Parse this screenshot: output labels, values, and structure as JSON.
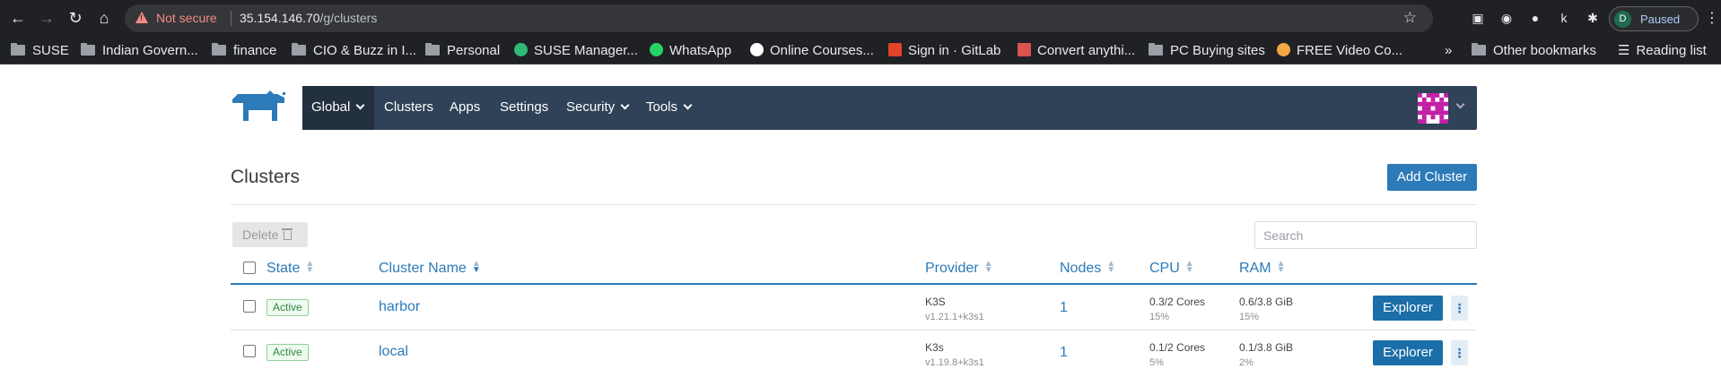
{
  "browser": {
    "not_secure_label": "Not secure",
    "url_host": "35.154.146.70",
    "url_path": "/g/clusters",
    "profile_initial": "D",
    "profile_status": "Paused"
  },
  "bookmarks": {
    "items": [
      {
        "label": "SUSE",
        "icon": "folder-icon"
      },
      {
        "label": "Indian Govern...",
        "icon": "folder-icon"
      },
      {
        "label": "finance",
        "icon": "folder-icon"
      },
      {
        "label": "CIO & Buzz in I...",
        "icon": "folder-icon"
      },
      {
        "label": "Personal",
        "icon": "folder-icon"
      },
      {
        "label": "SUSE Manager...",
        "icon": "suse-icon"
      },
      {
        "label": "WhatsApp",
        "icon": "whatsapp-icon"
      },
      {
        "label": "Online Courses...",
        "icon": "courses-icon"
      },
      {
        "label": "Sign in · GitLab",
        "icon": "gitlab-icon"
      },
      {
        "label": "Convert anythi...",
        "icon": "convert-icon"
      },
      {
        "label": "PC Buying sites",
        "icon": "folder-icon"
      },
      {
        "label": "FREE Video Co...",
        "icon": "video-icon"
      }
    ],
    "overflow": "»",
    "other": "Other bookmarks",
    "reading_list": "Reading list"
  },
  "nav": {
    "global": "Global",
    "clusters": "Clusters",
    "apps": "Apps",
    "settings": "Settings",
    "security": "Security",
    "tools": "Tools"
  },
  "page": {
    "title": "Clusters",
    "add_button": "Add Cluster",
    "delete_button": "Delete",
    "search_placeholder": "Search"
  },
  "table": {
    "columns": [
      "State",
      "Cluster Name",
      "Provider",
      "Nodes",
      "CPU",
      "RAM"
    ],
    "rows": [
      {
        "state": "Active",
        "name": "harbor",
        "provider": "K3S",
        "provider_version": "v1.21.1+k3s1",
        "nodes": "1",
        "cpu": "0.3/2 Cores",
        "cpu_pct": "15%",
        "ram": "0.6/3.8 GiB",
        "ram_pct": "15%",
        "action": "Explorer"
      },
      {
        "state": "Active",
        "name": "local",
        "provider": "K3s",
        "provider_version": "v1.19.8+k3s1",
        "nodes": "1",
        "cpu": "0.1/2 Cores",
        "cpu_pct": "5%",
        "ram": "0.1/3.8 GiB",
        "ram_pct": "2%",
        "action": "Explorer"
      }
    ]
  },
  "colors": {
    "accent": "#2c7ab8",
    "nav_bg": "#2f4257",
    "status_active": "#2e8b3e"
  }
}
